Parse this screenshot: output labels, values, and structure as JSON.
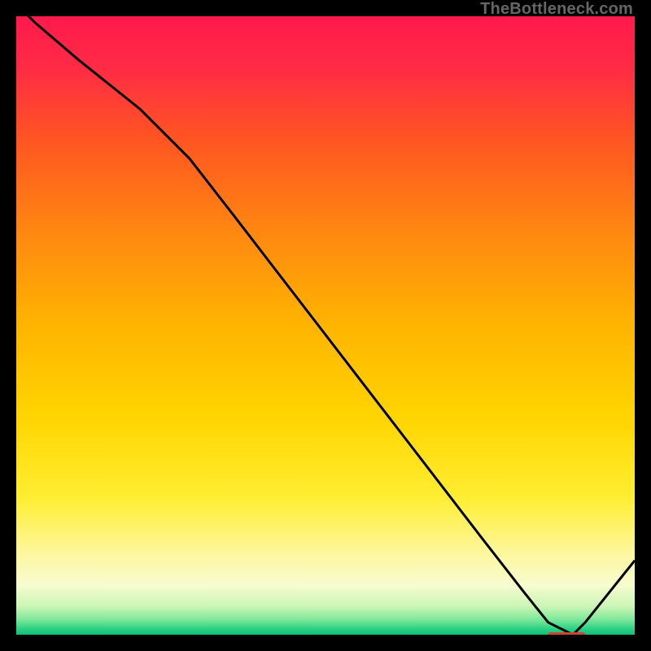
{
  "watermark": "TheBottleneck.com",
  "chart_data": {
    "type": "line",
    "title": "",
    "xlabel": "",
    "ylabel": "",
    "xlim": [
      0,
      100
    ],
    "ylim": [
      0,
      100
    ],
    "grid": false,
    "legend": false,
    "background": "vertical gradient red→orange→yellow→pale-yellow→green",
    "series": [
      {
        "name": "curve",
        "color": "#000000",
        "x": [
          0,
          3,
          10,
          20,
          28,
          35,
          45,
          55,
          65,
          75,
          82,
          86,
          90,
          92,
          96,
          100
        ],
        "y": [
          102,
          99,
          93,
          85,
          77,
          68,
          55,
          42,
          29,
          16,
          7,
          2,
          0,
          2,
          7,
          12
        ]
      }
    ],
    "annotations": [
      {
        "name": "flat-marker",
        "text": "",
        "position_x_range": [
          86,
          92
        ],
        "position_y": 0,
        "color": "#cc4433"
      }
    ],
    "gradient_stops": [
      {
        "offset": 0.0,
        "color": "#ff1a4d"
      },
      {
        "offset": 0.08,
        "color": "#ff2a45"
      },
      {
        "offset": 0.2,
        "color": "#ff5522"
      },
      {
        "offset": 0.35,
        "color": "#ff8811"
      },
      {
        "offset": 0.5,
        "color": "#ffb400"
      },
      {
        "offset": 0.65,
        "color": "#ffd500"
      },
      {
        "offset": 0.78,
        "color": "#ffee33"
      },
      {
        "offset": 0.87,
        "color": "#fdf7a0"
      },
      {
        "offset": 0.92,
        "color": "#f7fccf"
      },
      {
        "offset": 0.955,
        "color": "#c9f5b5"
      },
      {
        "offset": 0.975,
        "color": "#7fe89a"
      },
      {
        "offset": 0.99,
        "color": "#2fd184"
      },
      {
        "offset": 1.0,
        "color": "#0fbf77"
      }
    ]
  }
}
